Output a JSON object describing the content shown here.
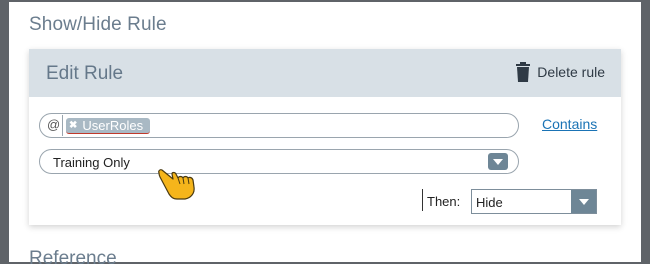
{
  "dialog": {
    "title": "Show/Hide Rule"
  },
  "rule_card": {
    "title": "Edit Rule",
    "delete_label": "Delete rule"
  },
  "condition": {
    "at_symbol": "@",
    "token_label": "UserRoles",
    "operator_link": "Contains",
    "value_selected": "Training Only"
  },
  "action": {
    "then_label": "Then:",
    "selected": "Hide"
  },
  "next_section": {
    "title": "Reference"
  },
  "colors": {
    "header_bg": "#d8e0e6",
    "title_text": "#6b7d8e",
    "link": "#1a73b5",
    "dropdown_button": "#6e8696",
    "token_bg": "#a9b9c4"
  },
  "icons": {
    "delete": "trash-icon",
    "token_remove": "close-icon",
    "dropdown": "caret-down-icon",
    "pointer": "hand-pointer-icon"
  }
}
